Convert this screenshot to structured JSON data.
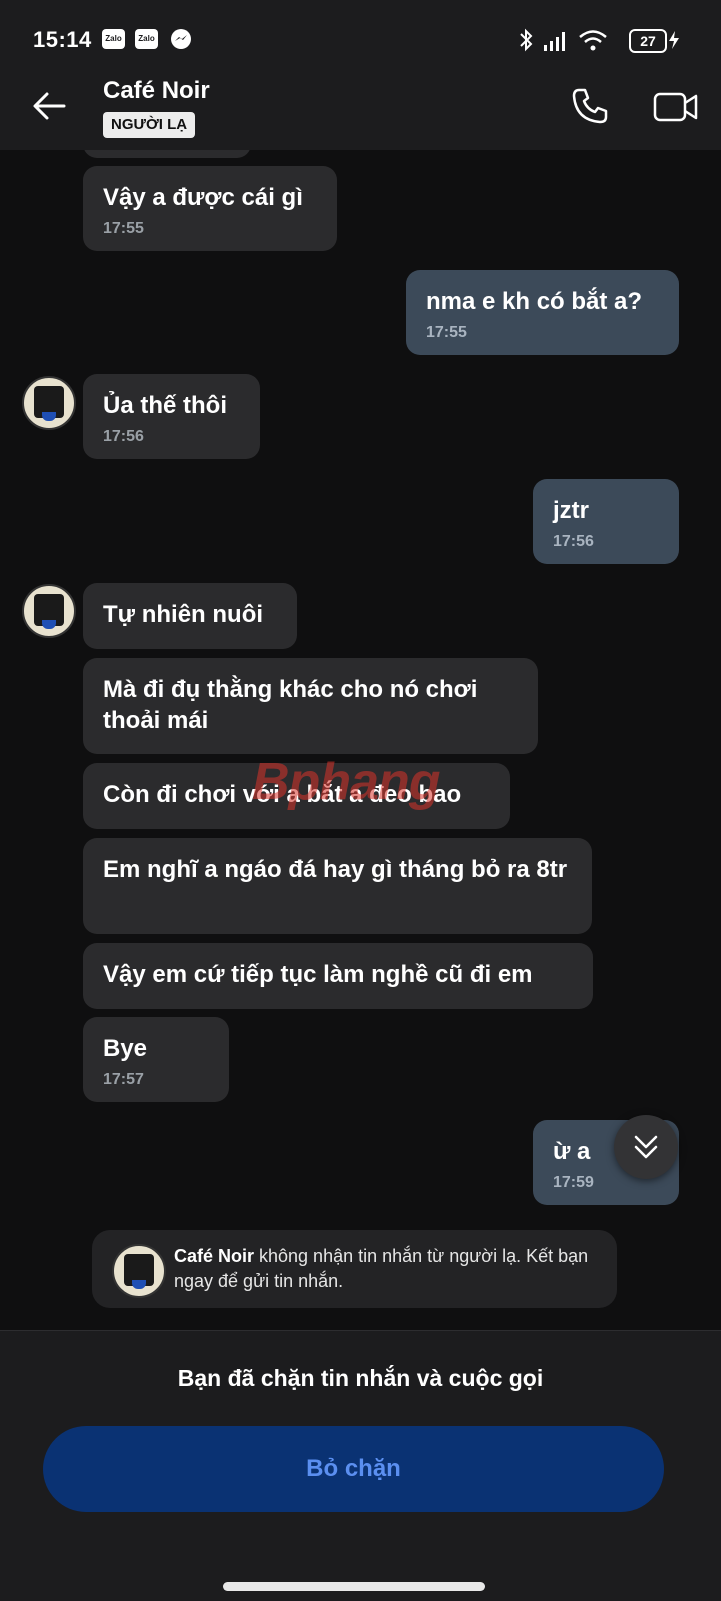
{
  "status_bar": {
    "time": "15:14",
    "app_icons": [
      "Zalo",
      "Zalo",
      "messenger-icon"
    ],
    "battery_level": "27"
  },
  "header": {
    "contact_name": "Café Noir",
    "badge": "NGƯỜI LẠ"
  },
  "messages": [
    {
      "side": "in",
      "text": "Vậy a được cái gì",
      "time": "17:55"
    },
    {
      "side": "out",
      "text": "nma e kh có bắt a?",
      "time": "17:55"
    },
    {
      "side": "in",
      "text": "Ủa thế thôi",
      "time": "17:56"
    },
    {
      "side": "out",
      "text": "jztr",
      "time": "17:56"
    },
    {
      "side": "in",
      "text": "Tự nhiên nuôi",
      "time": ""
    },
    {
      "side": "in",
      "text": "Mà đi đụ thằng khác cho nó chơi thoải mái",
      "time": ""
    },
    {
      "side": "in",
      "text": "Còn đi chơi với a bắt a đeo bao",
      "time": ""
    },
    {
      "side": "in",
      "text": "Em nghĩ a ngáo đá hay gì tháng bỏ ra 8tr",
      "time": ""
    },
    {
      "side": "in",
      "text": "Vậy em cứ tiếp tục làm nghề cũ đi em",
      "time": ""
    },
    {
      "side": "in",
      "text": "Bye",
      "time": "17:57"
    },
    {
      "side": "out",
      "text": "ừ a",
      "time": "17:59"
    }
  ],
  "notice": {
    "name": "Café Noir",
    "text": " không nhận tin nhắn từ người lạ. Kết bạn ngay để gửi tin nhắn."
  },
  "bottom": {
    "blocked_text": "Bạn đã chặn tin nhắn và cuộc gọi",
    "unblock_label": "Bỏ chặn"
  },
  "watermark": "Bphang",
  "colors": {
    "background": "#0f0f10",
    "incoming_bubble": "#2b2b2d",
    "outgoing_bubble": "#3c4a59",
    "unblock_button": "#0a3273",
    "unblock_text": "#5b8ff0"
  }
}
